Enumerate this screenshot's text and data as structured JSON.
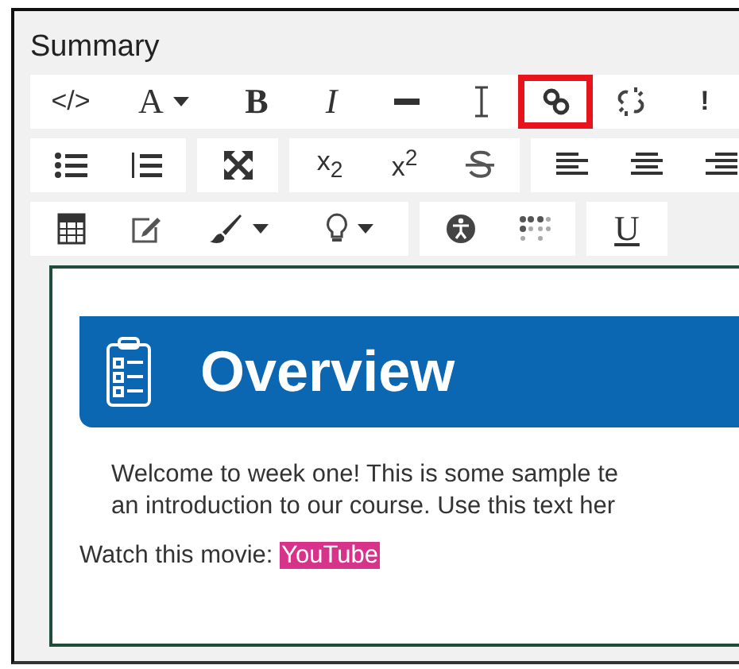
{
  "title": "Summary",
  "toolbar": [
    [
      {
        "buttons": [
          {
            "kind": "code",
            "text": "</>"
          },
          {
            "kind": "font",
            "text": "A",
            "caret": true
          },
          {
            "kind": "bold",
            "text": "B"
          },
          {
            "kind": "italic",
            "text": "I"
          },
          {
            "kind": "hr"
          },
          {
            "kind": "ibeam"
          },
          {
            "kind": "link",
            "highlighted": true
          },
          {
            "kind": "unlink"
          },
          {
            "kind": "important",
            "text": "!"
          }
        ]
      }
    ],
    [
      {
        "buttons": [
          {
            "kind": "ul"
          },
          {
            "kind": "ol"
          }
        ]
      },
      {
        "buttons": [
          {
            "kind": "expand"
          }
        ]
      },
      {
        "buttons": [
          {
            "kind": "subscript",
            "text": "x$_{2}$"
          },
          {
            "kind": "superscript",
            "text": "x$^{2}$"
          },
          {
            "kind": "strike"
          }
        ]
      },
      {
        "buttons": [
          {
            "kind": "align-left"
          },
          {
            "kind": "align-center"
          },
          {
            "kind": "align-right"
          }
        ]
      }
    ],
    [
      {
        "buttons": [
          {
            "kind": "table"
          },
          {
            "kind": "edit"
          },
          {
            "kind": "brush",
            "caret": true
          },
          {
            "kind": "bulb",
            "caret": true
          }
        ]
      },
      {
        "buttons": [
          {
            "kind": "accessibility"
          },
          {
            "kind": "dots"
          }
        ]
      },
      {
        "buttons": [
          {
            "kind": "underline",
            "text": "U"
          }
        ]
      }
    ]
  ],
  "content": {
    "banner": {
      "title": "Overview"
    },
    "intro_lines": [
      "Welcome to week one! This is some sample te",
      "an introduction to our course. Use this text her"
    ],
    "watch": {
      "label": "Watch this movie: ",
      "link": "YouTube"
    }
  }
}
